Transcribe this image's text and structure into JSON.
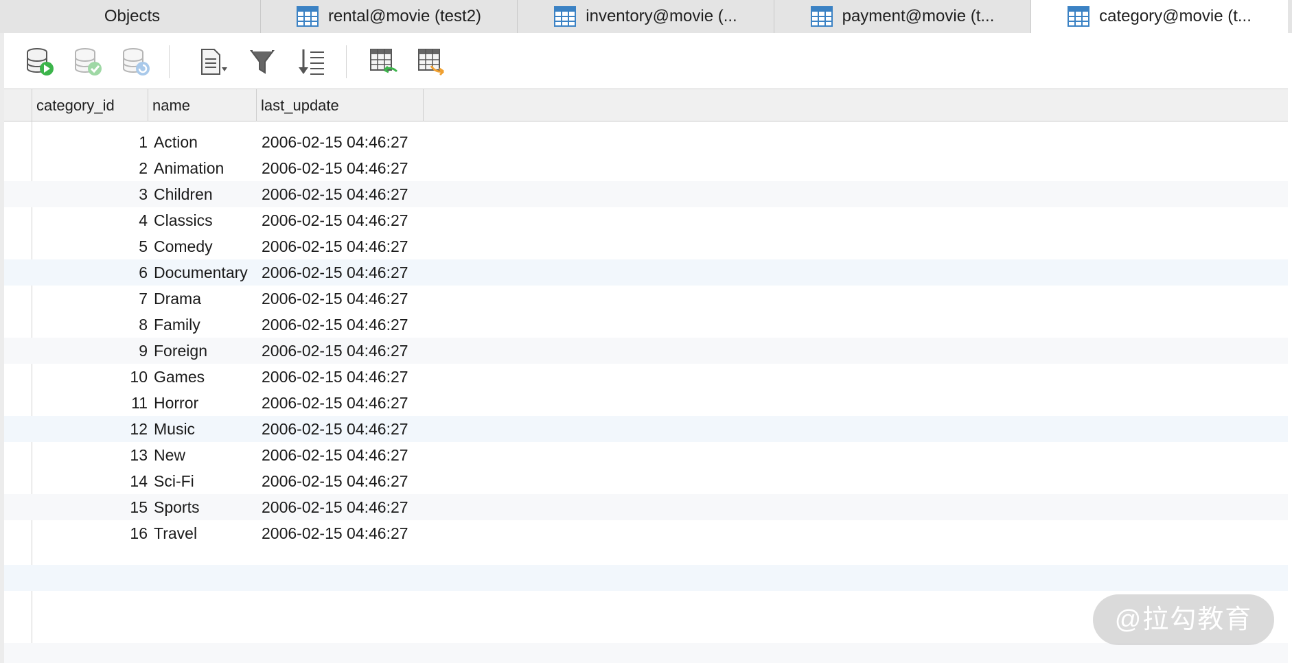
{
  "tabs": [
    {
      "label": "Objects",
      "icon": "none",
      "active": false
    },
    {
      "label": "rental@movie (test2)",
      "icon": "table-icon",
      "active": false
    },
    {
      "label": "inventory@movie (...",
      "icon": "table-icon",
      "active": false
    },
    {
      "label": "payment@movie (t...",
      "icon": "table-icon",
      "active": false
    },
    {
      "label": "category@movie (t...",
      "icon": "table-icon",
      "active": true
    }
  ],
  "toolbar": {
    "buttons": [
      "db-run-icon",
      "db-commit-icon",
      "db-refresh-icon",
      "text-view-icon",
      "filter-icon",
      "sort-icon",
      "import-icon",
      "export-icon"
    ]
  },
  "grid": {
    "columns": [
      "category_id",
      "name",
      "last_update"
    ],
    "rows": [
      {
        "id": "1",
        "name": "Action",
        "last_update": "2006-02-15 04:46:27"
      },
      {
        "id": "2",
        "name": "Animation",
        "last_update": "2006-02-15 04:46:27"
      },
      {
        "id": "3",
        "name": "Children",
        "last_update": "2006-02-15 04:46:27"
      },
      {
        "id": "4",
        "name": "Classics",
        "last_update": "2006-02-15 04:46:27"
      },
      {
        "id": "5",
        "name": "Comedy",
        "last_update": "2006-02-15 04:46:27"
      },
      {
        "id": "6",
        "name": "Documentary",
        "last_update": "2006-02-15 04:46:27"
      },
      {
        "id": "7",
        "name": "Drama",
        "last_update": "2006-02-15 04:46:27"
      },
      {
        "id": "8",
        "name": "Family",
        "last_update": "2006-02-15 04:46:27"
      },
      {
        "id": "9",
        "name": "Foreign",
        "last_update": "2006-02-15 04:46:27"
      },
      {
        "id": "10",
        "name": "Games",
        "last_update": "2006-02-15 04:46:27"
      },
      {
        "id": "11",
        "name": "Horror",
        "last_update": "2006-02-15 04:46:27"
      },
      {
        "id": "12",
        "name": "Music",
        "last_update": "2006-02-15 04:46:27"
      },
      {
        "id": "13",
        "name": "New",
        "last_update": "2006-02-15 04:46:27"
      },
      {
        "id": "14",
        "name": "Sci-Fi",
        "last_update": "2006-02-15 04:46:27"
      },
      {
        "id": "15",
        "name": "Sports",
        "last_update": "2006-02-15 04:46:27"
      },
      {
        "id": "16",
        "name": "Travel",
        "last_update": "2006-02-15 04:46:27"
      }
    ]
  },
  "watermark": "@拉勾教育",
  "colors": {
    "accent_blue": "#3b82c4",
    "run_green": "#3cb44b",
    "export_orange": "#f0a030"
  }
}
